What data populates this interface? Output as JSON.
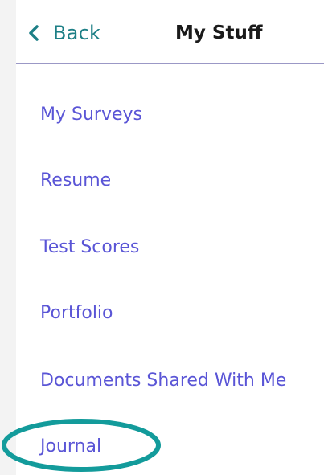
{
  "header": {
    "back_label": "Back",
    "title": "My Stuff",
    "back_icon": "chevron-left-icon"
  },
  "menu": {
    "items": [
      {
        "label": "My Surveys"
      },
      {
        "label": "Resume"
      },
      {
        "label": "Test Scores"
      },
      {
        "label": "Portfolio"
      },
      {
        "label": "Documents Shared With Me"
      },
      {
        "label": "Journal"
      }
    ]
  },
  "colors": {
    "accent_teal": "#1d7f86",
    "link_purple": "#5a55d6",
    "divider": "#9b98c6",
    "highlight": "#139b9b"
  }
}
